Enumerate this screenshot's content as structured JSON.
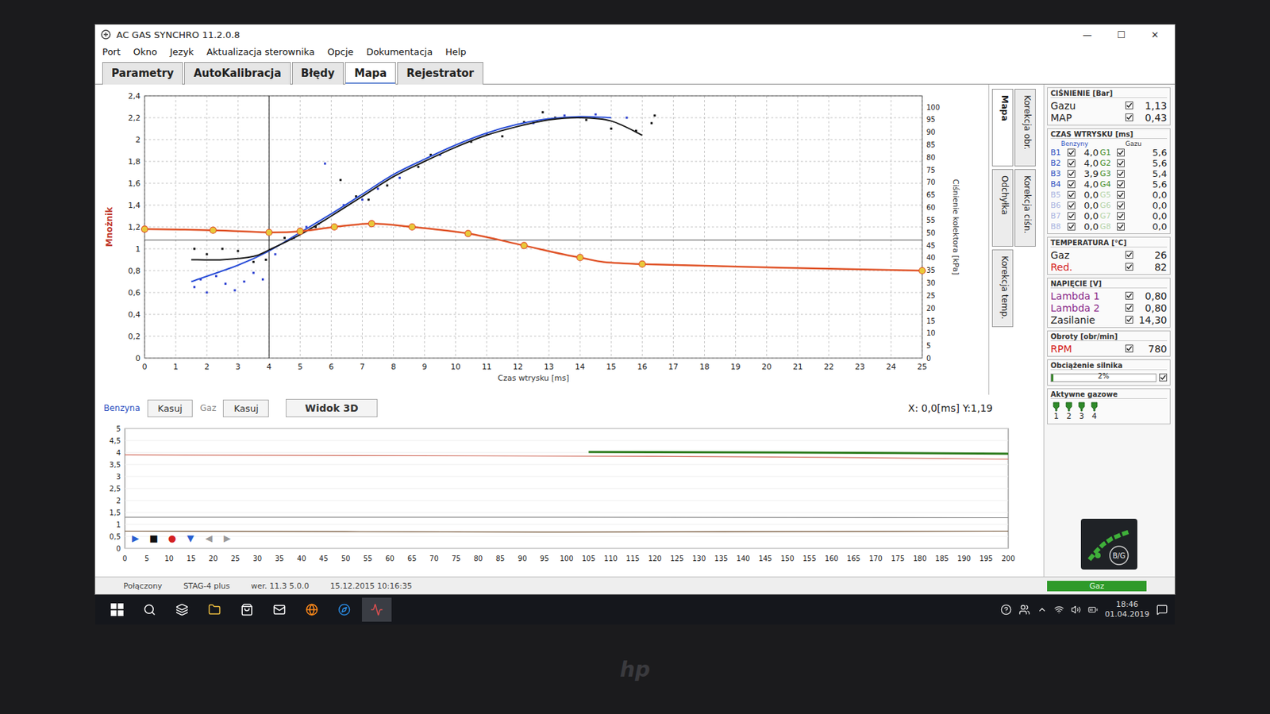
{
  "window": {
    "title": "AC GAS SYNCHRO 11.2.0.8",
    "controls": [
      "—",
      "☐",
      "✕"
    ]
  },
  "menu": [
    "Port",
    "Okno",
    "Jezyk",
    "Aktualizacja sterownika",
    "Opcje",
    "Dokumentacja",
    "Help"
  ],
  "tabs": [
    {
      "label": "Parametry",
      "selected": false
    },
    {
      "label": "AutoKalibracja",
      "selected": false
    },
    {
      "label": "Błędy",
      "selected": false
    },
    {
      "label": "Mapa",
      "selected": true
    },
    {
      "label": "Rejestrator",
      "selected": false
    }
  ],
  "map_chart": {
    "y_label": "Mnożnik",
    "x_label": "Czas wtrysku [ms]",
    "right_label": "Ciśnienie kolektora [kPa]",
    "y_ticks": [
      "0",
      "0,2",
      "0,4",
      "0,6",
      "0,8",
      "1",
      "1,2",
      "1,4",
      "1,6",
      "1,8",
      "2",
      "2,2",
      "2,4"
    ],
    "x_ticks": [
      "0",
      "1",
      "2",
      "3",
      "4",
      "5",
      "6",
      "7",
      "8",
      "9",
      "10",
      "11",
      "12",
      "13",
      "14",
      "15",
      "16",
      "17",
      "18",
      "19",
      "20",
      "21",
      "22",
      "23",
      "24",
      "25"
    ],
    "right_ticks": [
      "0",
      "5",
      "10",
      "15",
      "20",
      "25",
      "30",
      "35",
      "40",
      "45",
      "50",
      "55",
      "60",
      "65",
      "70",
      "75",
      "80",
      "85",
      "90",
      "95",
      "100"
    ],
    "cursor": {
      "x": 4.0,
      "y": 1.08
    },
    "series": [
      {
        "kind": "scatter",
        "color": "#2b3fd0",
        "points": [
          [
            1.6,
            0.65
          ],
          [
            1.8,
            0.72
          ],
          [
            2.0,
            0.6
          ],
          [
            2.3,
            0.75
          ],
          [
            2.6,
            0.68
          ],
          [
            2.9,
            0.62
          ],
          [
            3.2,
            0.7
          ],
          [
            3.5,
            0.78
          ],
          [
            3.8,
            0.72
          ],
          [
            4.2,
            0.95
          ],
          [
            4.8,
            1.1
          ],
          [
            5.2,
            1.2
          ],
          [
            5.6,
            1.23
          ],
          [
            5.8,
            1.78
          ],
          [
            6.4,
            1.4
          ],
          [
            7.0,
            1.45
          ],
          [
            7.5,
            1.55
          ],
          [
            8.2,
            1.65
          ],
          [
            9.5,
            1.86
          ],
          [
            11.0,
            2.05
          ],
          [
            12.5,
            2.15
          ],
          [
            13.5,
            2.22
          ],
          [
            14.5,
            2.23
          ],
          [
            15.5,
            2.2
          ]
        ]
      },
      {
        "kind": "scatter",
        "color": "#111111",
        "points": [
          [
            1.6,
            1.0
          ],
          [
            2.0,
            0.95
          ],
          [
            2.5,
            1.0
          ],
          [
            3.0,
            0.98
          ],
          [
            3.5,
            0.88
          ],
          [
            3.9,
            0.9
          ],
          [
            4.5,
            1.1
          ],
          [
            5.5,
            1.2
          ],
          [
            6.3,
            1.63
          ],
          [
            6.8,
            1.48
          ],
          [
            7.2,
            1.45
          ],
          [
            7.8,
            1.58
          ],
          [
            8.8,
            1.75
          ],
          [
            9.2,
            1.86
          ],
          [
            10.5,
            1.98
          ],
          [
            11.5,
            2.03
          ],
          [
            12.2,
            2.16
          ],
          [
            12.8,
            2.25
          ],
          [
            13.2,
            2.2
          ],
          [
            14.2,
            2.18
          ],
          [
            15.0,
            2.1
          ],
          [
            15.8,
            2.08
          ],
          [
            16.3,
            2.15
          ],
          [
            16.4,
            2.22
          ]
        ]
      },
      {
        "kind": "line",
        "color": "#2b4fd8",
        "points": [
          [
            1.5,
            0.7
          ],
          [
            3.0,
            0.85
          ],
          [
            4.0,
            0.98
          ],
          [
            5.0,
            1.15
          ],
          [
            6.0,
            1.32
          ],
          [
            7.0,
            1.5
          ],
          [
            8.0,
            1.68
          ],
          [
            9.0,
            1.82
          ],
          [
            10.0,
            1.95
          ],
          [
            11.0,
            2.06
          ],
          [
            12.0,
            2.14
          ],
          [
            13.0,
            2.19
          ],
          [
            14.0,
            2.21
          ],
          [
            15.0,
            2.2
          ]
        ]
      },
      {
        "kind": "line",
        "color": "#1a1a1a",
        "points": [
          [
            1.5,
            0.9
          ],
          [
            2.5,
            0.9
          ],
          [
            3.5,
            0.93
          ],
          [
            4.0,
            0.99
          ],
          [
            5.0,
            1.13
          ],
          [
            6.0,
            1.3
          ],
          [
            7.0,
            1.48
          ],
          [
            8.0,
            1.66
          ],
          [
            9.0,
            1.8
          ],
          [
            10.0,
            1.93
          ],
          [
            11.0,
            2.04
          ],
          [
            12.0,
            2.12
          ],
          [
            13.0,
            2.18
          ],
          [
            14.0,
            2.2
          ],
          [
            15.0,
            2.17
          ],
          [
            16.0,
            2.04
          ]
        ]
      },
      {
        "kind": "map",
        "color": "#e0552a",
        "points": [
          [
            0,
            1.18
          ],
          [
            2.2,
            1.17
          ],
          [
            4.0,
            1.15
          ],
          [
            5.0,
            1.16
          ],
          [
            6.1,
            1.2
          ],
          [
            7.3,
            1.23
          ],
          [
            8.6,
            1.2
          ],
          [
            10.4,
            1.14
          ],
          [
            12.2,
            1.03
          ],
          [
            14.0,
            0.92
          ],
          [
            16.0,
            0.86
          ],
          [
            25.0,
            0.8
          ]
        ]
      }
    ]
  },
  "side_tabs": [
    {
      "label": "Mapa",
      "selected": true
    },
    {
      "label": "Korekcja obr.",
      "selected": false
    },
    {
      "label": "Odchyłka",
      "selected": false
    },
    {
      "label": "Korekcja ciśn.",
      "selected": false
    },
    {
      "label": "Korekcja temp.",
      "selected": false
    }
  ],
  "controls": {
    "petrol": {
      "label": "Benzyna",
      "button": "Kasuj",
      "active": true
    },
    "gas": {
      "label": "Gaz",
      "button": "Kasuj",
      "active": false
    },
    "view3d": "Widok 3D",
    "readout": "X: 0,0[ms] Y:1,19"
  },
  "recorder": {
    "y_ticks": [
      "0",
      "0,5",
      "1",
      "1,5",
      "2",
      "2,5",
      "3",
      "3,5",
      "4",
      "4,5",
      "5"
    ],
    "x_ticks": [
      "0",
      "5",
      "10",
      "15",
      "20",
      "25",
      "30",
      "35",
      "40",
      "45",
      "50",
      "55",
      "60",
      "65",
      "70",
      "75",
      "80",
      "85",
      "90",
      "95",
      "100",
      "105",
      "110",
      "115",
      "120",
      "125",
      "130",
      "135",
      "140",
      "145",
      "150",
      "155",
      "160",
      "165",
      "170",
      "175",
      "180",
      "185",
      "190",
      "195",
      "200"
    ],
    "series": [
      {
        "color": "#d06a5a",
        "points": [
          [
            0,
            3.9
          ],
          [
            40,
            3.88
          ],
          [
            80,
            3.86
          ],
          [
            120,
            3.84
          ],
          [
            160,
            3.8
          ],
          [
            200,
            3.72
          ]
        ]
      },
      {
        "color": "#2f7d1f",
        "points": [
          [
            105,
            4.02
          ],
          [
            150,
            4.0
          ],
          [
            200,
            3.95
          ]
        ]
      },
      {
        "color": "#8a8a8a",
        "points": [
          [
            0,
            1.3
          ],
          [
            100,
            1.3
          ],
          [
            200,
            1.28
          ]
        ]
      },
      {
        "color": "#6b4a2a",
        "points": [
          [
            0,
            0.72
          ],
          [
            50,
            0.7
          ],
          [
            100,
            0.68
          ],
          [
            150,
            0.7
          ],
          [
            200,
            0.72
          ]
        ]
      }
    ],
    "buttons": [
      {
        "symbol": "▶",
        "color": "#2a5fd0",
        "disabled": false
      },
      {
        "symbol": "■",
        "color": "#111111",
        "disabled": false
      },
      {
        "symbol": "●",
        "color": "#d42020",
        "disabled": false
      },
      {
        "symbol": "▼",
        "color": "#2a5fd0",
        "disabled": false
      },
      {
        "symbol": "◀",
        "color": "#9a9a9a",
        "disabled": true
      },
      {
        "symbol": "▶",
        "color": "#9a9a9a",
        "disabled": true
      }
    ]
  },
  "panel": {
    "pressure": {
      "title": "CIŚNIENIE [Bar]",
      "rows": [
        {
          "label": "Gazu",
          "checked": true,
          "value": "1,13",
          "color": "#1a1a1a"
        },
        {
          "label": "MAP",
          "checked": true,
          "value": "0,43",
          "color": "#1a1a1a"
        }
      ]
    },
    "injection": {
      "title": "CZAS WTRYSKU [ms]",
      "petrol_header": "Benzyny",
      "gas_header": "Gazu",
      "rows": [
        {
          "b": "B1",
          "b_value": "4,0",
          "g": "G1",
          "g_value": "5,6",
          "checked": true,
          "enabled": true
        },
        {
          "b": "B2",
          "b_value": "4,0",
          "g": "G2",
          "g_value": "5,6",
          "checked": true,
          "enabled": true
        },
        {
          "b": "B3",
          "b_value": "3,9",
          "g": "G3",
          "g_value": "5,4",
          "checked": true,
          "enabled": true
        },
        {
          "b": "B4",
          "b_value": "4,0",
          "g": "G4",
          "g_value": "5,6",
          "checked": true,
          "enabled": true
        },
        {
          "b": "B5",
          "b_value": "0,0",
          "g": "G5",
          "g_value": "0,0",
          "checked": true,
          "enabled": false
        },
        {
          "b": "B6",
          "b_value": "0,0",
          "g": "G6",
          "g_value": "0,0",
          "checked": true,
          "enabled": false
        },
        {
          "b": "B7",
          "b_value": "0,0",
          "g": "G7",
          "g_value": "0,0",
          "checked": true,
          "enabled": false
        },
        {
          "b": "B8",
          "b_value": "0,0",
          "g": "G8",
          "g_value": "0,0",
          "checked": true,
          "enabled": false
        }
      ]
    },
    "temperature": {
      "title": "TEMPERATURA [°C]",
      "rows": [
        {
          "label": "Gaz",
          "checked": true,
          "value": "26",
          "color": "#1a1a1a"
        },
        {
          "label": "Red.",
          "checked": true,
          "value": "82",
          "color": "#d42020"
        }
      ]
    },
    "voltage": {
      "title": "NAPIĘCIE [V]",
      "rows": [
        {
          "label": "Lambda 1",
          "checked": true,
          "value": "0,80",
          "color": "#8a2a8a"
        },
        {
          "label": "Lambda 2",
          "checked": true,
          "value": "0,80",
          "color": "#8a2a8a"
        },
        {
          "label": "Zasilanie",
          "checked": true,
          "value": "14,30",
          "color": "#1a1a1a"
        }
      ]
    },
    "rpm": {
      "title": "Obroty [obr/min]",
      "rows": [
        {
          "label": "RPM",
          "checked": true,
          "value": "780",
          "color": "#d42020"
        }
      ]
    },
    "load": {
      "title": "Obciążenie silnika",
      "value": "2%",
      "level": 0.02,
      "checked": true
    },
    "injectors": {
      "title": "Aktywne gazowe",
      "items": [
        {
          "label": "1",
          "active": true
        },
        {
          "label": "2",
          "active": true
        },
        {
          "label": "3",
          "active": true
        },
        {
          "label": "4",
          "active": true
        }
      ]
    },
    "switch": {
      "label": "B/G",
      "mode": "Gaz"
    }
  },
  "status_bar": {
    "connection": "Połączony",
    "device": "STAG-4 plus",
    "version": "wer. 11.3 5.0.0",
    "date": "15.12.2015 10:16:35"
  },
  "taskbar": {
    "time": "18:46",
    "date": "01.04.2019"
  },
  "bezel_logo": "hp"
}
